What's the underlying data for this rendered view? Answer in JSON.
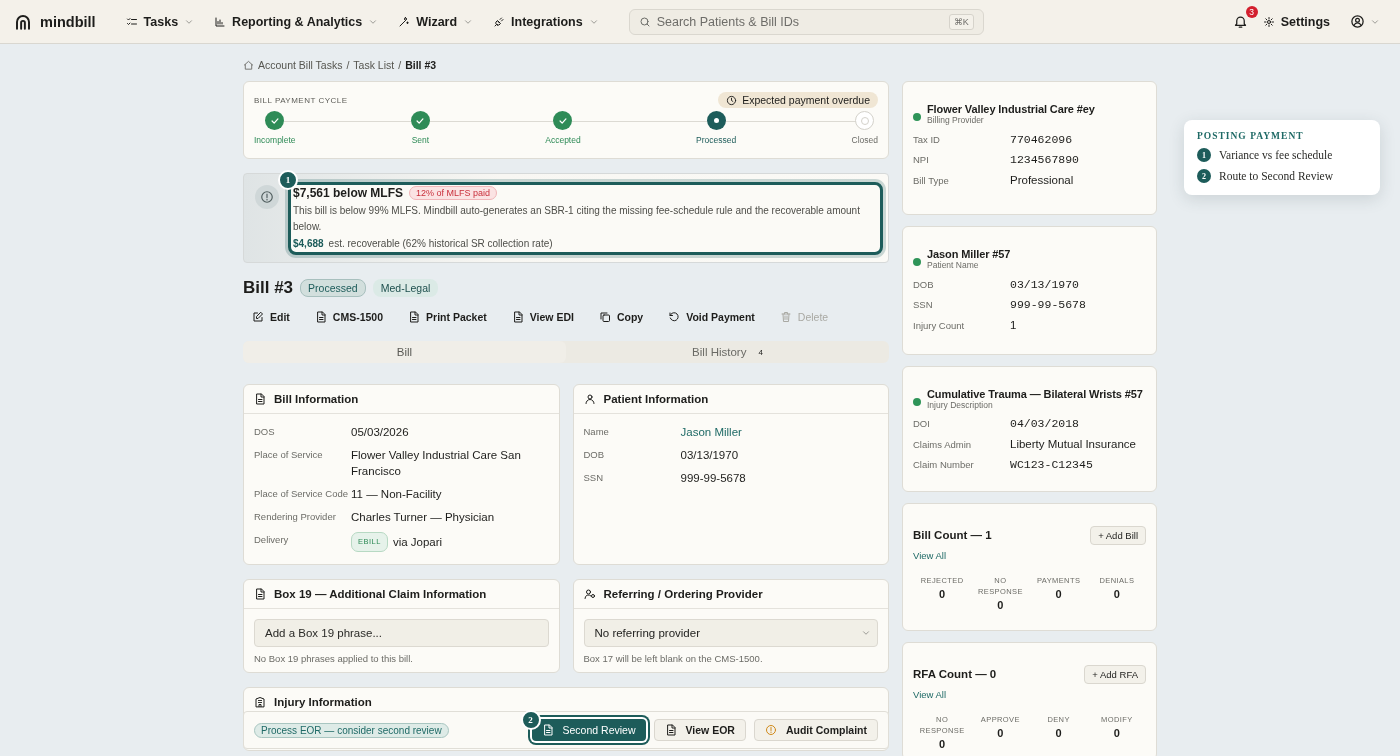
{
  "nav": {
    "logo": "mindbill",
    "menus": [
      {
        "label": "Tasks"
      },
      {
        "label": "Reporting & Analytics"
      },
      {
        "label": "Wizard"
      },
      {
        "label": "Integrations"
      }
    ],
    "search": {
      "placeholder": "Search Patients & Bill IDs",
      "shortcut": "⌘K"
    },
    "notifications": "3",
    "settings": "Settings"
  },
  "breadcrumb": {
    "separator": "/",
    "items": [
      "Account Bill Tasks",
      "Task List",
      "Bill #3"
    ]
  },
  "payment_cycle": {
    "title": "BILL PAYMENT CYCLE",
    "alert": "Expected payment overdue",
    "steps": [
      {
        "label": "Incomplete",
        "completed": true,
        "current": false
      },
      {
        "label": "Sent",
        "completed": true,
        "current": false
      },
      {
        "label": "Accepted",
        "completed": true,
        "current": false
      },
      {
        "label": "Processed",
        "completed": false,
        "current": true
      },
      {
        "label": "Closed",
        "completed": false,
        "current": false
      }
    ]
  },
  "variance": {
    "step": "1",
    "title": "$7,561 below MLFS",
    "badge": "12% of MLFS paid",
    "text": "This bill is below 99% MLFS. Mindbill auto-generates an SBR-1 citing the missing fee-schedule rule and the recoverable amount below.",
    "amount": "$4,688",
    "amount_note": "est. recoverable (62% historical SR collection rate)"
  },
  "bill": {
    "title": "Bill #3",
    "tags": [
      {
        "label": "Processed",
        "kind": "status"
      },
      {
        "label": "Med-Legal",
        "kind": "category"
      }
    ]
  },
  "actions": [
    {
      "label": "Edit",
      "disabled": false
    },
    {
      "label": "CMS-1500",
      "disabled": false
    },
    {
      "label": "Print Packet",
      "disabled": false
    },
    {
      "label": "View EDI",
      "disabled": false
    },
    {
      "label": "Copy",
      "disabled": false
    },
    {
      "label": "Void Payment",
      "disabled": false
    },
    {
      "label": "Delete",
      "disabled": true
    }
  ],
  "tabs": [
    {
      "label": "Bill",
      "selected": true
    },
    {
      "label": "Bill History",
      "count": "4",
      "selected": false
    }
  ],
  "bill_information": {
    "title": "Bill Information",
    "rows": [
      {
        "label": "DOS",
        "value": "05/03/2026",
        "kind": "text"
      },
      {
        "label": "Place of Service",
        "value": "Flower Valley Industrial Care San Francisco",
        "kind": "text"
      },
      {
        "label": "Place of Service Code",
        "value": "11 — Non-Facility",
        "kind": "text"
      },
      {
        "label": "Rendering Provider",
        "value": "Charles Turner — Physician",
        "kind": "text"
      },
      {
        "label": "Delivery",
        "badge": "EBILL",
        "value": "via Jopari",
        "kind": "badge"
      }
    ]
  },
  "patient_information": {
    "title": "Patient Information",
    "rows": [
      {
        "label": "Name",
        "value": "Jason Miller",
        "kind": "link"
      },
      {
        "label": "DOB",
        "value": "03/13/1970",
        "kind": "text"
      },
      {
        "label": "SSN",
        "value": "999-99-5678",
        "kind": "text"
      }
    ]
  },
  "box19": {
    "title": "Box 19 — Additional Claim Information",
    "placeholder": "Add a Box 19 phrase...",
    "note": "No Box 19 phrases applied to this bill."
  },
  "referring": {
    "title": "Referring / Ordering Provider",
    "value": "No referring provider",
    "note": "Box 17 will be left blank on the CMS-1500."
  },
  "injury": {
    "title": "Injury Information"
  },
  "action_bar": {
    "tag": "Process EOR — consider second review",
    "buttons": [
      {
        "label": "Second Review",
        "kind": "primary",
        "step": "2"
      },
      {
        "label": "View EOR",
        "kind": "secondary"
      },
      {
        "label": "Audit Complaint",
        "kind": "warning"
      }
    ]
  },
  "summary_cards": [
    {
      "title": "Flower Valley Industrial Care #ey",
      "subtitle": "Billing Provider",
      "color": "#2e9458",
      "rows": [
        {
          "label": "Tax ID",
          "value": "770462096",
          "mono": true
        },
        {
          "label": "NPI",
          "value": "1234567890",
          "mono": true
        },
        {
          "label": "Bill Type",
          "value": "Professional",
          "mono": false
        }
      ]
    },
    {
      "title": "Jason Miller #57",
      "subtitle": "Patient Name",
      "color": "#2e9458",
      "rows": [
        {
          "label": "DOB",
          "value": "03/13/1970",
          "mono": true
        },
        {
          "label": "SSN",
          "value": "999-99-5678",
          "mono": true
        },
        {
          "label": "Injury Count",
          "value": "1",
          "mono": false
        }
      ]
    },
    {
      "title": "Cumulative Trauma — Bilateral Wrists #57",
      "subtitle": "Injury Description",
      "color": "#2e9458",
      "rows": [
        {
          "label": "DOI",
          "value": "04/03/2018",
          "mono": true
        },
        {
          "label": "Claims Admin",
          "value": "Liberty Mutual Insurance",
          "mono": false
        },
        {
          "label": "Claim Number",
          "value": "WC123-C12345",
          "mono": true
        }
      ]
    }
  ],
  "count_cards": [
    {
      "title": "Bill Count — 1",
      "button": "+ Add Bill",
      "link": "View All",
      "stats": [
        {
          "label": "REJECTED",
          "value": "0"
        },
        {
          "label": "NO RESPONSE",
          "value": "0"
        },
        {
          "label": "PAYMENTS",
          "value": "0"
        },
        {
          "label": "DENIALS",
          "value": "0"
        }
      ]
    },
    {
      "title": "RFA Count — 0",
      "button": "+ Add RFA",
      "link": "View All",
      "stats": [
        {
          "label": "NO RESPONSE",
          "value": "0"
        },
        {
          "label": "APPROVE",
          "value": "0"
        },
        {
          "label": "DENY",
          "value": "0"
        },
        {
          "label": "MODIFY",
          "value": "0"
        }
      ]
    }
  ],
  "guide": {
    "title": "POSTING PAYMENT",
    "steps": [
      {
        "number": "1",
        "label": "Variance vs fee schedule"
      },
      {
        "number": "2",
        "label": "Route to Second Review"
      }
    ]
  }
}
